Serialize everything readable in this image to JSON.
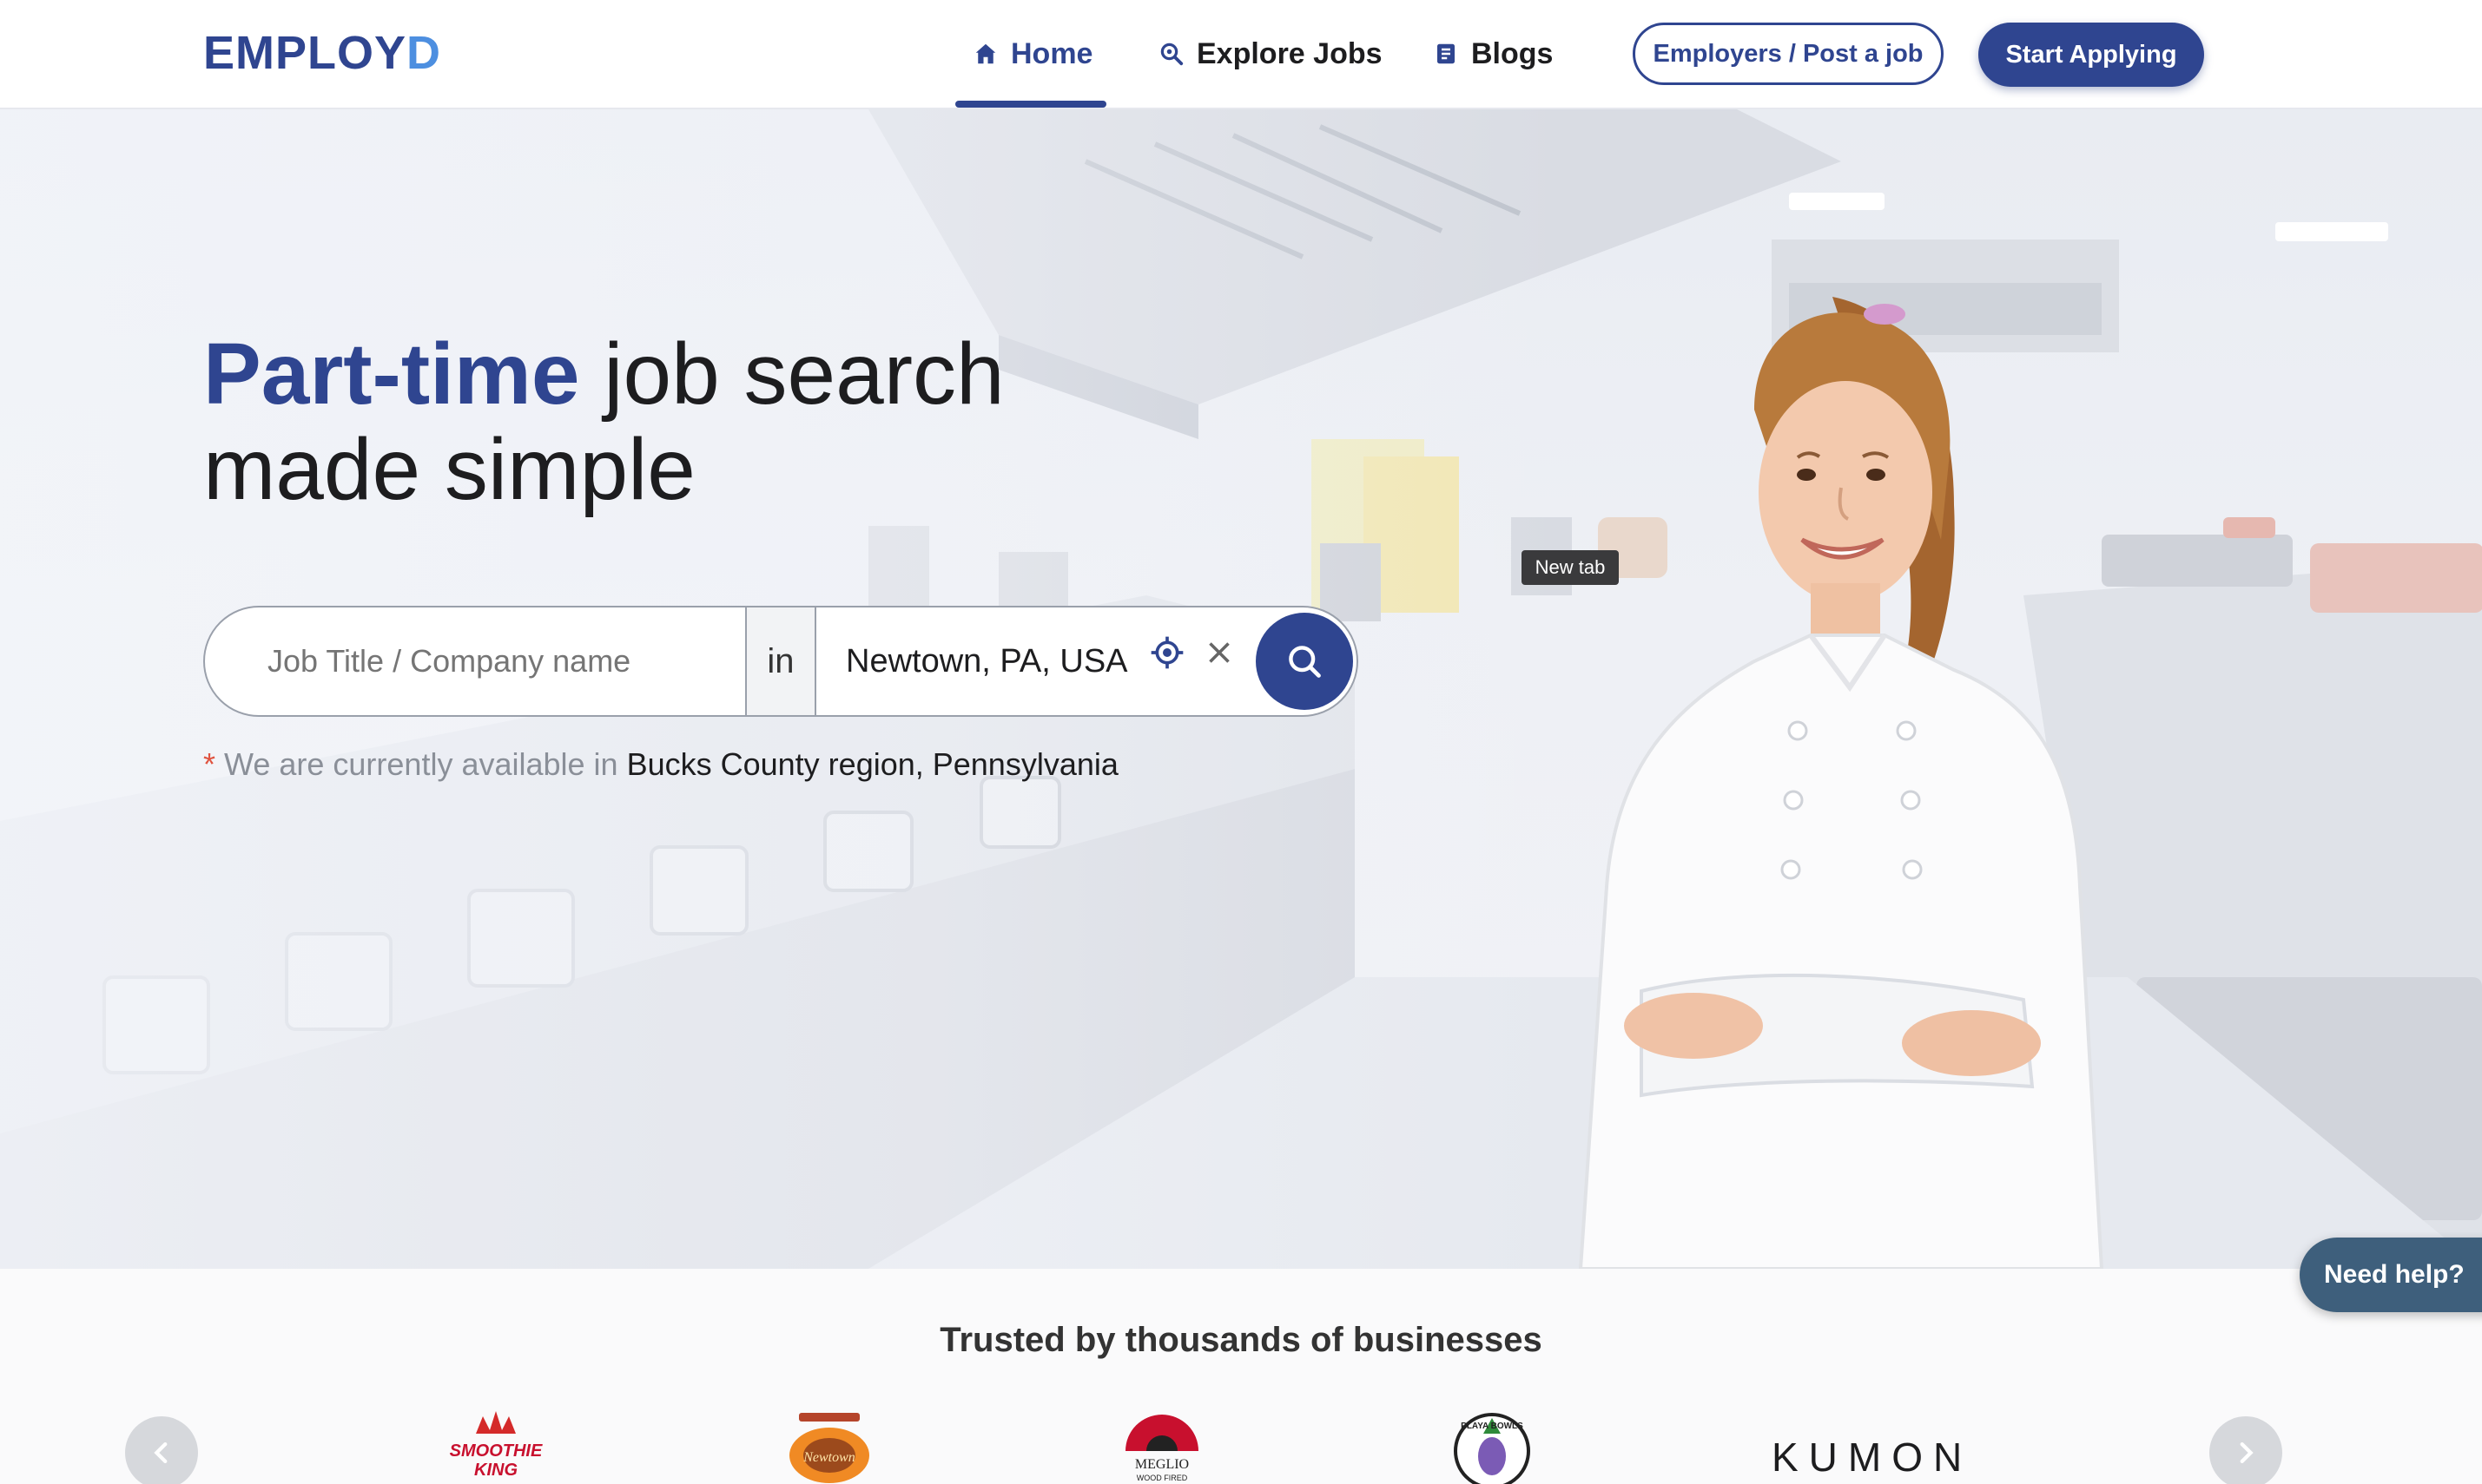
{
  "brand": {
    "name_main": "EMPLOY",
    "name_accent": "D"
  },
  "nav": {
    "items": [
      {
        "label": "Home",
        "icon": "home-icon",
        "active": true
      },
      {
        "label": "Explore Jobs",
        "icon": "search-jobs-icon",
        "active": false
      },
      {
        "label": "Blogs",
        "icon": "blog-icon",
        "active": false
      }
    ],
    "employers_label": "Employers / Post a job",
    "start_label": "Start Applying"
  },
  "hero": {
    "headline_strong": "Part-time",
    "headline_rest": " job search",
    "headline_line2": "made simple",
    "search": {
      "job_placeholder": "Job Title / Company name",
      "in_label": "in",
      "location_value": "Newtown, PA, USA"
    },
    "tooltip": "New tab",
    "availability_star": "*",
    "availability_prefix": " We are currently available in ",
    "availability_region": "Bucks County region, Pennsylvania"
  },
  "help": {
    "label": "Need help?"
  },
  "trusted": {
    "title": "Trusted by thousands of businesses",
    "logos": [
      "Smoothie King",
      "Newtown",
      "Meglio Wood Fired",
      "Playa Bowls",
      "KUMON"
    ]
  },
  "colors": {
    "primary": "#2f4590",
    "accent": "#4d8fe0",
    "help": "#3e5f7c"
  }
}
